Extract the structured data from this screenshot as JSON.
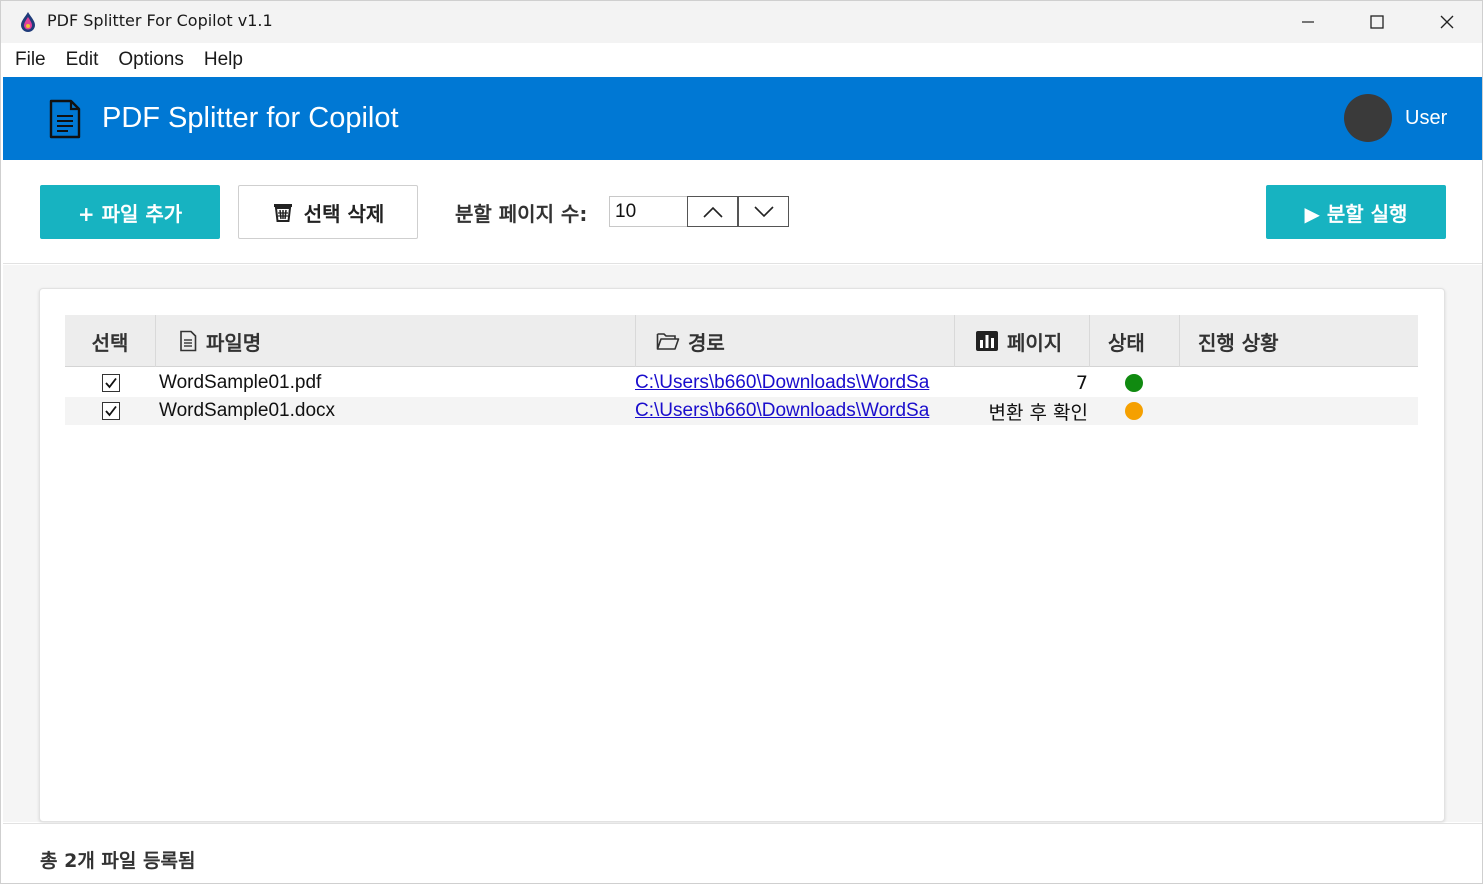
{
  "window": {
    "title": "PDF Splitter For Copilot v1.1",
    "minimize_icon": "minimize-icon",
    "maximize_icon": "maximize-icon",
    "close_icon": "close-icon"
  },
  "menu": {
    "items": [
      "File",
      "Edit",
      "Options",
      "Help"
    ]
  },
  "header": {
    "title": "PDF Splitter for Copilot",
    "user_name": "User",
    "brand_color": "#0078d4"
  },
  "toolbar": {
    "add_label": "+ 파일 추가",
    "delete_label": "선택 삭제",
    "split_pages_label": "분할 페이지 수:",
    "split_pages_value": "10",
    "run_label": "▶ 분할 실행",
    "accent_color": "#17b3c1"
  },
  "table": {
    "headers": {
      "select": "선택",
      "filename": "파일명",
      "path": "경로",
      "pages": "페이지",
      "status": "상태",
      "progress": "진행 상황"
    },
    "rows": [
      {
        "checked": true,
        "filename": "WordSample01.pdf",
        "path": "C:\\Users\\b660\\Downloads\\WordSa",
        "pages": "7",
        "status_color": "#108a10",
        "progress": ""
      },
      {
        "checked": true,
        "filename": "WordSample01.docx",
        "path": "C:\\Users\\b660\\Downloads\\WordSa",
        "pages": "변환 후 확인",
        "status_color": "#f5a000",
        "progress": ""
      }
    ]
  },
  "footer": {
    "summary": "총 2개 파일 등록됨"
  }
}
